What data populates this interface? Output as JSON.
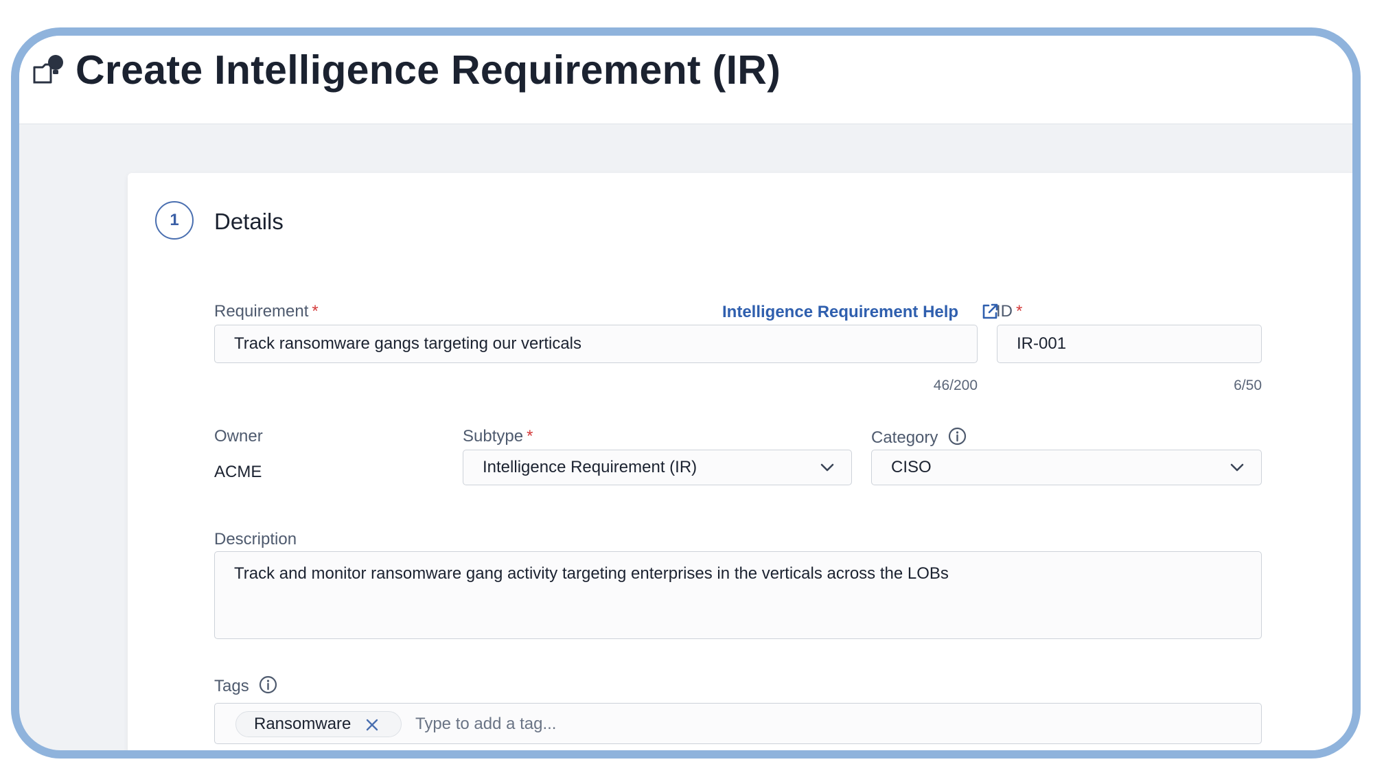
{
  "page": {
    "title": "Create Intelligence Requirement (IR)",
    "icon": "lightbulb-folder-icon"
  },
  "step": {
    "number": "1",
    "title": "Details"
  },
  "form": {
    "requirement": {
      "label": "Requirement",
      "required_mark": "*",
      "value": "Track ransomware gangs targeting our verticals",
      "counter": "46/200",
      "help_link": "Intelligence Requirement Help"
    },
    "id": {
      "label": "ID",
      "required_mark": "*",
      "value": "IR-001",
      "counter": "6/50"
    },
    "owner": {
      "label": "Owner",
      "value": "ACME"
    },
    "subtype": {
      "label": "Subtype",
      "required_mark": "*",
      "value": "Intelligence Requirement (IR)"
    },
    "category": {
      "label": "Category",
      "value": "CISO"
    },
    "description": {
      "label": "Description",
      "value": "Track and monitor ransomware gang activity targeting enterprises in the verticals across the LOBs"
    },
    "tags": {
      "label": "Tags",
      "items": [
        "Ransomware"
      ],
      "placeholder": "Type to add a tag..."
    }
  },
  "colors": {
    "frame_border": "#8fb3dc",
    "link": "#2f5fae",
    "required": "#d43b3b",
    "text": "#1b2230"
  }
}
